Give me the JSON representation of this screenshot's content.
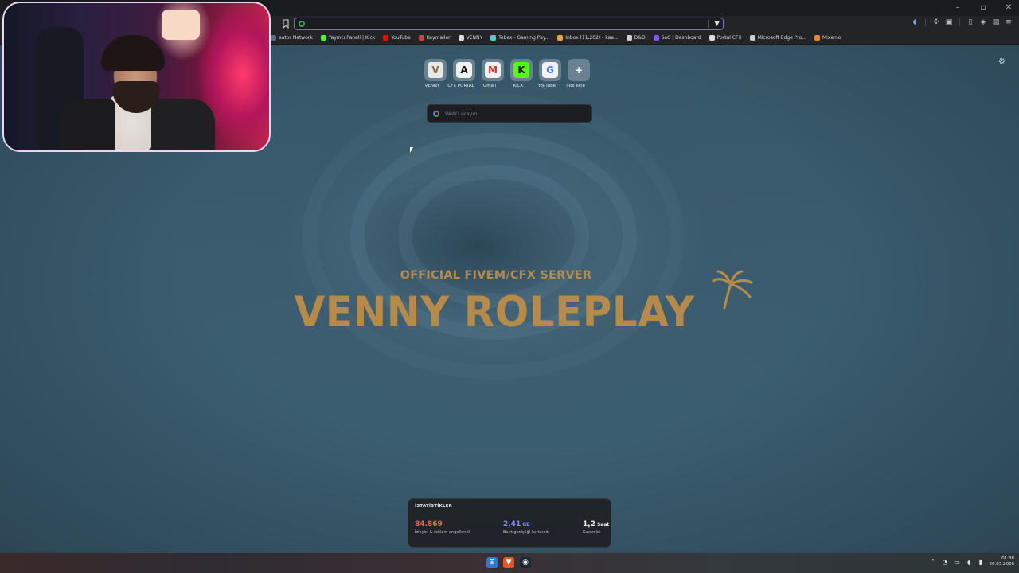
{
  "browser": {
    "address_value": "",
    "bookmarks": [
      {
        "label": "eator Network",
        "icon": "globe-icon",
        "color": "#5a6b8c"
      },
      {
        "label": "Yayıncı Paneli | Kick",
        "icon": "kick-icon",
        "color": "#53fc18"
      },
      {
        "label": "YouTube",
        "icon": "youtube-icon",
        "color": "#ff0000"
      },
      {
        "label": "Keymailer",
        "icon": "keymailer-icon",
        "color": "#e03a3a"
      },
      {
        "label": "VENNY",
        "icon": "venny-icon",
        "color": "#dddddd"
      },
      {
        "label": "Tebex - Gaming Pay...",
        "icon": "tebex-icon",
        "color": "#4fd1c5"
      },
      {
        "label": "Inbox (11,202) - kaa...",
        "icon": "mail-icon",
        "color": "#f2a33a"
      },
      {
        "label": "D&D",
        "icon": "folder-icon",
        "color": "#cccccc"
      },
      {
        "label": "SaC | Dashboard",
        "icon": "sac-icon",
        "color": "#8a4fff"
      },
      {
        "label": "Portal CFX",
        "icon": "cfx-icon",
        "color": "#dddddd"
      },
      {
        "label": "Microsoft Edge Pro...",
        "icon": "folder-icon",
        "color": "#cccccc"
      },
      {
        "label": "Mixamo",
        "icon": "mixamo-icon",
        "color": "#e8872b"
      }
    ]
  },
  "shortcuts": [
    {
      "label": "VENNY",
      "glyph": "V",
      "bg": "#e8e8e8",
      "fg": "#8a6a3a"
    },
    {
      "label": "CFX PORTAL",
      "glyph": "A",
      "bg": "#f2f2f2",
      "fg": "#111111"
    },
    {
      "label": "Gmail",
      "glyph": "M",
      "bg": "#f2f2f2",
      "fg": "#d93025"
    },
    {
      "label": "KICK",
      "glyph": "K",
      "bg": "#53fc18",
      "fg": "#0b0b0b"
    },
    {
      "label": "YouTube",
      "glyph": "G",
      "bg": "#f2f2f2",
      "fg": "#4285f4"
    },
    {
      "label": "Site ekle",
      "glyph": "+",
      "bg": "transparent",
      "fg": "#ffffff"
    }
  ],
  "search": {
    "placeholder": "Web'i arayın"
  },
  "brand": {
    "subtitle": "OFFICIAL FIVEM/CFX SERVER",
    "title": "VENNY ROLEPLAY",
    "color": "#b58a4a"
  },
  "stats": {
    "title": "İSTATİSTİKLER",
    "items": [
      {
        "value": "84.869",
        "unit": "",
        "label": "İzleyici & reklam engellendi",
        "color": "#e56b4f"
      },
      {
        "value": "2,41",
        "unit": "GB",
        "label": "Bant genişliği kurtarıldı",
        "color": "#7f8de8"
      },
      {
        "value": "1,2",
        "unit": "Saat",
        "label": "Kazanıldı",
        "color": "#f0f0f0"
      }
    ]
  },
  "taskbar": {
    "time": "01:38",
    "date": "26.03.2026"
  }
}
